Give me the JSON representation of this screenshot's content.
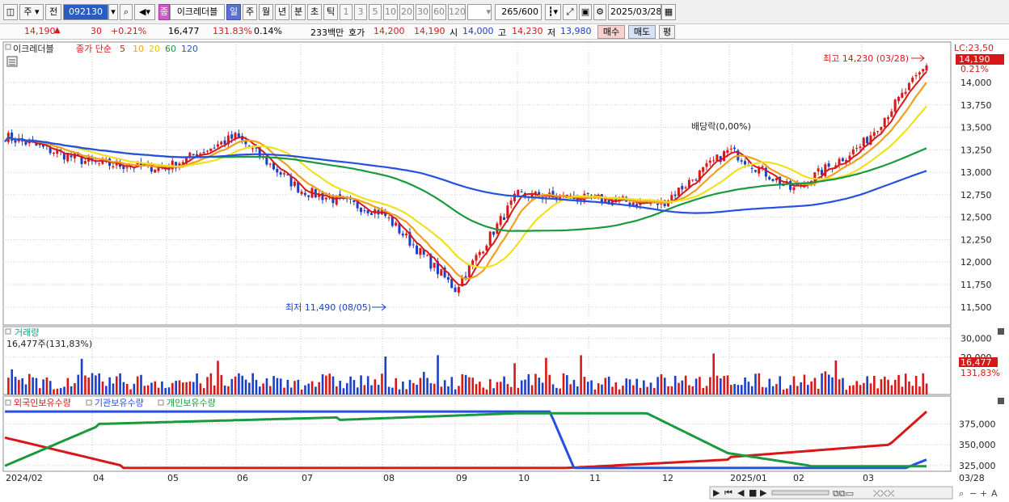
{
  "toolbar": {
    "market": "주",
    "prev_label": "전",
    "code": "092130",
    "name": "이크레더블",
    "periods": [
      "일",
      "주",
      "월",
      "년",
      "분",
      "초",
      "틱"
    ],
    "active_period": "일",
    "intervals": [
      "1",
      "3",
      "5",
      "10",
      "20",
      "30",
      "60",
      "120"
    ],
    "count": "265/600",
    "date": "2025/03/28"
  },
  "info": {
    "price": "14,190",
    "change": "30",
    "change_pct": "+0.21%",
    "volume": "16,477",
    "volume_ratio": "131.83%",
    "turnover": "0.14%",
    "amount": "233백만",
    "bid_label": "호가",
    "bid": "14,200",
    "ask": "14,190",
    "open_label": "시",
    "open": "14,000",
    "high_label": "고",
    "high": "14,230",
    "low_label": "저",
    "low": "13,980",
    "buy_label": "매수",
    "sell_label": "매도",
    "eval_label": "평"
  },
  "price_panel": {
    "stock_tag": "이크레더블",
    "ma_label": "종가 단순",
    "ma_periods": [
      "5",
      "10",
      "20",
      "60",
      "120"
    ],
    "ma_colors": [
      "#d81818",
      "#f0a020",
      "#f0e020",
      "#199a3c",
      "#2850e0"
    ],
    "lc_label": "LC:23,50",
    "last_price_tag": "14,190",
    "last_change_tag": "0.21%",
    "max_note": "최고 14,230 (03/28)",
    "min_note": "최저 11,490 (08/05)",
    "div_note": "배당락(0,00%)",
    "y_ticks": [
      "14,000",
      "13,750",
      "13,500",
      "13,250",
      "13,000",
      "12,750",
      "12,500",
      "12,250",
      "12,000",
      "11,750",
      "11,500"
    ]
  },
  "volume_panel": {
    "title": "거래량",
    "value": "16,477주(131,83%)",
    "y_ticks": [
      "30,000",
      "20,000"
    ],
    "last_tag": "16,477",
    "last_pct_tag": "131,83%"
  },
  "holding_panel": {
    "legend": [
      "외국인보유수량",
      "기관보유수량",
      "개인보유수량"
    ],
    "colors": [
      "#d81818",
      "#2850e0",
      "#199a3c"
    ],
    "y_ticks": [
      "375,000",
      "350,000",
      "325,000"
    ]
  },
  "x_labels": [
    "2024/02",
    "04",
    "05",
    "06",
    "07",
    "08",
    "09",
    "10",
    "11",
    "12",
    "2025/01",
    "02",
    "03",
    "03/28"
  ],
  "chart_data": {
    "type": "line",
    "title": "",
    "xlabel": "",
    "ylabel": "",
    "x": [
      "2024/02",
      "04",
      "05",
      "06",
      "07",
      "08",
      "09",
      "10",
      "11",
      "12",
      "2025/01",
      "02",
      "03",
      "03/28"
    ],
    "ylim": [
      11300,
      14450
    ],
    "series": [
      {
        "name": "종가",
        "values": [
          13400,
          13100,
          13050,
          13400,
          12800,
          12550,
          11700,
          12750,
          12700,
          12650,
          13250,
          12800,
          13300,
          14190
        ]
      }
    ],
    "volume_ylim": [
      0,
      32000
    ],
    "holding_ylim": [
      318000,
      395000
    ]
  }
}
